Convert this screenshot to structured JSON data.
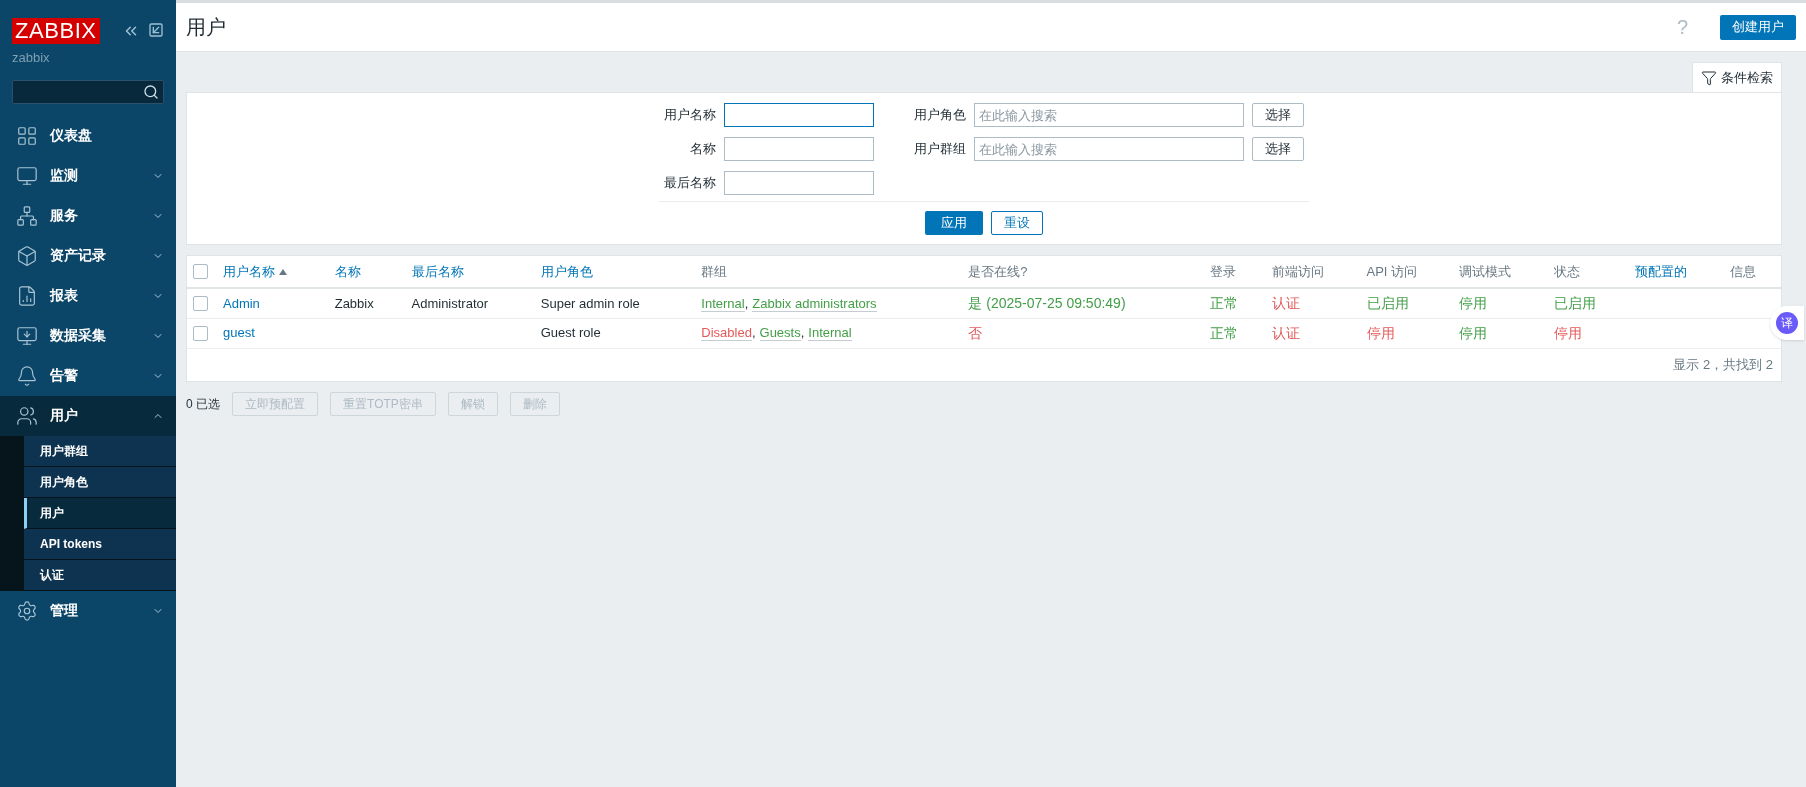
{
  "sidebar": {
    "logo": "ZABBIX",
    "server": "zabbix",
    "items": [
      {
        "kind": "dashboard",
        "label": "仪表盘",
        "expanded": false,
        "has_children": false
      },
      {
        "kind": "monitor",
        "label": "监测",
        "expanded": false,
        "has_children": true
      },
      {
        "kind": "network",
        "label": "服务",
        "expanded": false,
        "has_children": true
      },
      {
        "kind": "box",
        "label": "资产记录",
        "expanded": false,
        "has_children": true
      },
      {
        "kind": "report",
        "label": "报表",
        "expanded": false,
        "has_children": true
      },
      {
        "kind": "collect",
        "label": "数据采集",
        "expanded": false,
        "has_children": true
      },
      {
        "kind": "bell",
        "label": "告警",
        "expanded": false,
        "has_children": true
      },
      {
        "kind": "users",
        "label": "用户",
        "expanded": true,
        "has_children": true,
        "children": [
          {
            "label": "用户群组",
            "selected": false
          },
          {
            "label": "用户角色",
            "selected": false
          },
          {
            "label": "用户",
            "selected": true
          },
          {
            "label": "API tokens",
            "selected": false
          },
          {
            "label": "认证",
            "selected": false
          }
        ]
      },
      {
        "kind": "gear",
        "label": "管理",
        "expanded": false,
        "has_children": true
      }
    ]
  },
  "header": {
    "title": "用户",
    "help": "?",
    "create_button": "创建用户"
  },
  "filter_tab": {
    "label": "条件检索"
  },
  "filter": {
    "left": [
      {
        "label": "用户名称",
        "focused": true
      },
      {
        "label": "名称",
        "focused": false
      },
      {
        "label": "最后名称",
        "focused": false
      }
    ],
    "right": [
      {
        "label": "用户角色",
        "placeholder": "在此输入搜索",
        "button": "选择"
      },
      {
        "label": "用户群组",
        "placeholder": "在此输入搜索",
        "button": "选择"
      }
    ],
    "apply": "应用",
    "reset": "重设"
  },
  "table": {
    "select_all": {
      "checked": false
    },
    "group_separator": ",",
    "columns": [
      {
        "label": "用户名称",
        "sortable": true,
        "sorted": true
      },
      {
        "label": "名称",
        "sortable": true,
        "sorted": false
      },
      {
        "label": "最后名称",
        "sortable": true,
        "sorted": false
      },
      {
        "label": "用户角色",
        "sortable": true,
        "sorted": false
      },
      {
        "label": "群组",
        "sortable": false,
        "sorted": false
      },
      {
        "label": "是否在线?",
        "sortable": false,
        "sorted": false
      },
      {
        "label": "登录",
        "sortable": false,
        "sorted": false
      },
      {
        "label": "前端访问",
        "sortable": false,
        "sorted": false
      },
      {
        "label": "API 访问",
        "sortable": false,
        "sorted": false
      },
      {
        "label": "调试模式",
        "sortable": false,
        "sorted": false
      },
      {
        "label": "状态",
        "sortable": false,
        "sorted": false
      },
      {
        "label": "预配置的",
        "sortable": true,
        "sorted": false
      },
      {
        "label": "信息",
        "sortable": false,
        "sorted": false
      }
    ],
    "rows": [
      {
        "checked": false,
        "username": "Admin",
        "name": "Zabbix",
        "surname": "Administrator",
        "role": "Super admin role",
        "groups": [
          {
            "name": "Internal",
            "color": "#429e47"
          },
          {
            "name": "Zabbix administrators",
            "color": "#429e47"
          }
        ],
        "online": {
          "text": "是 (2025-07-25 09:50:49)",
          "color": "#429e47"
        },
        "login": {
          "text": "正常",
          "color": "#429e47"
        },
        "frontend": {
          "text": "认证",
          "color": "#e45959"
        },
        "api": {
          "text": "已启用",
          "color": "#429e47"
        },
        "debug": {
          "text": "停用",
          "color": "#429e47"
        },
        "status": {
          "text": "已启用",
          "color": "#429e47"
        }
      },
      {
        "checked": false,
        "username": "guest",
        "role": "Guest role",
        "groups": [
          {
            "name": "Disabled",
            "color": "#e45959"
          },
          {
            "name": "Guests",
            "color": "#429e47"
          },
          {
            "name": "Internal",
            "color": "#429e47"
          }
        ],
        "online": {
          "text": "否",
          "color": "#e45959"
        },
        "login": {
          "text": "正常",
          "color": "#429e47"
        },
        "frontend": {
          "text": "认证",
          "color": "#e45959"
        },
        "api": {
          "text": "停用",
          "color": "#e45959"
        },
        "debug": {
          "text": "停用",
          "color": "#429e47"
        },
        "status": {
          "text": "停用",
          "color": "#e45959"
        }
      }
    ],
    "footer": "显示 2，共找到 2"
  },
  "actions": {
    "selected_count": "0 已选",
    "buttons": [
      {
        "label": "立即预配置",
        "disabled": true
      },
      {
        "label": "重置TOTP密串",
        "disabled": true
      },
      {
        "label": "解锁",
        "disabled": true
      },
      {
        "label": "删除",
        "disabled": true
      }
    ]
  },
  "translate_bubble": "译"
}
